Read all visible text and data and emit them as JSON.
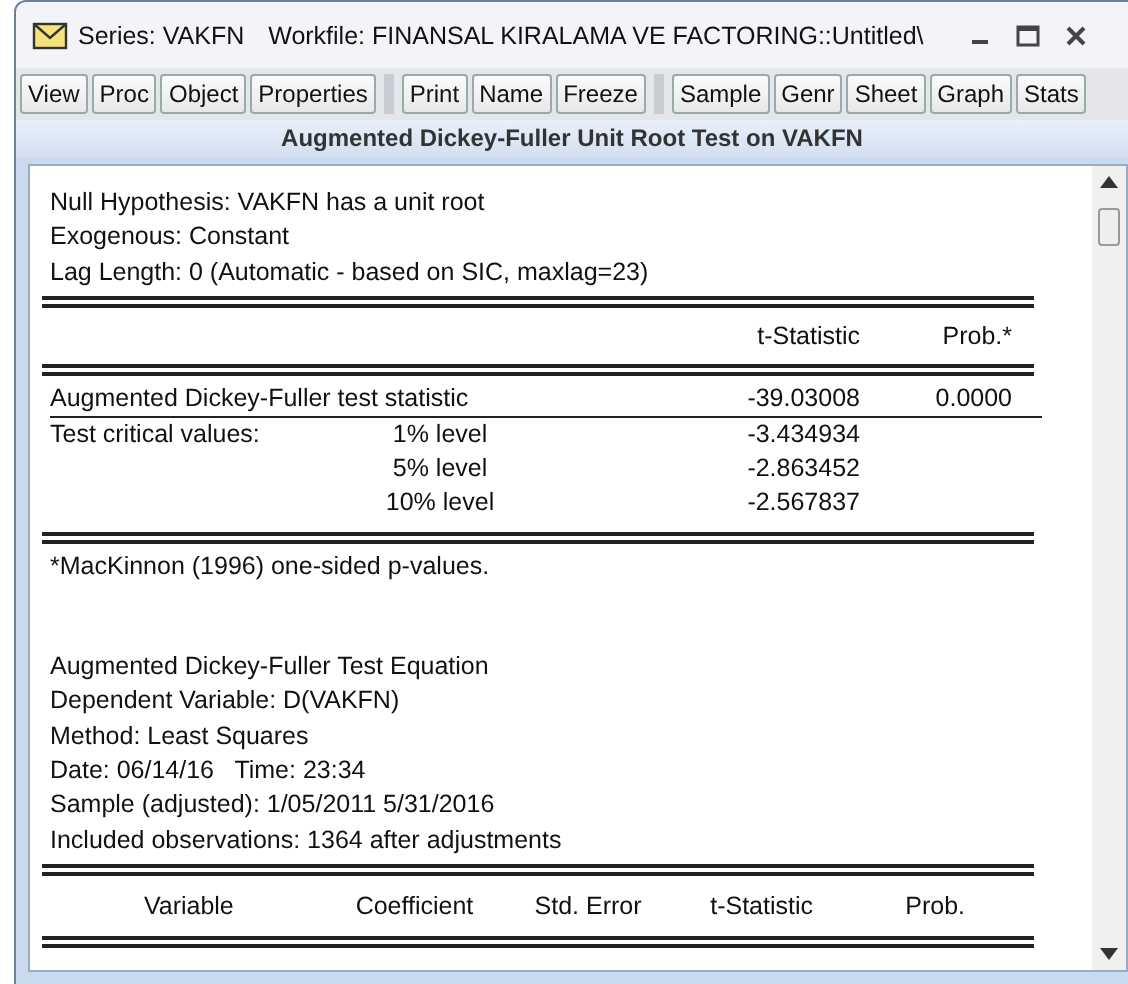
{
  "window": {
    "title": "Series: VAKFN",
    "workfile": "Workfile: FINANSAL KIRALAMA VE FACTORING::Untitled\\"
  },
  "toolbar": [
    [
      "View",
      "Proc",
      "Object",
      "Properties"
    ],
    [
      "Print",
      "Name",
      "Freeze"
    ],
    [
      "Sample",
      "Genr",
      "Sheet",
      "Graph",
      "Stats"
    ]
  ],
  "header": "Augmented Dickey-Fuller Unit Root Test on VAKFN",
  "intro": [
    "Null Hypothesis: VAKFN has a unit root",
    "Exogenous: Constant",
    "Lag Length: 0 (Automatic - based on SIC, maxlag=23)"
  ],
  "test_table": {
    "columns": [
      "t-Statistic",
      "Prob.*"
    ],
    "rows": [
      {
        "label": "Augmented Dickey-Fuller test statistic",
        "level": "",
        "t_statistic": "-39.03008",
        "prob": "0.0000"
      },
      {
        "label": "Test critical values:",
        "level": "1% level",
        "t_statistic": "-3.434934",
        "prob": ""
      },
      {
        "label": "",
        "level": "5% level",
        "t_statistic": "-2.863452",
        "prob": ""
      },
      {
        "label": "",
        "level": "10% level",
        "t_statistic": "-2.567837",
        "prob": ""
      }
    ]
  },
  "footnote": "*MacKinnon (1996) one-sided p-values.",
  "equation": [
    "Augmented Dickey-Fuller Test Equation",
    "Dependent Variable: D(VAKFN)",
    "Method: Least Squares",
    "Date: 06/14/16   Time: 23:34",
    "Sample (adjusted): 1/05/2011 5/31/2016",
    "Included observations: 1364 after adjustments"
  ],
  "coefficient_columns": [
    "Variable",
    "Coefficient",
    "Std. Error",
    "t-Statistic",
    "Prob."
  ]
}
